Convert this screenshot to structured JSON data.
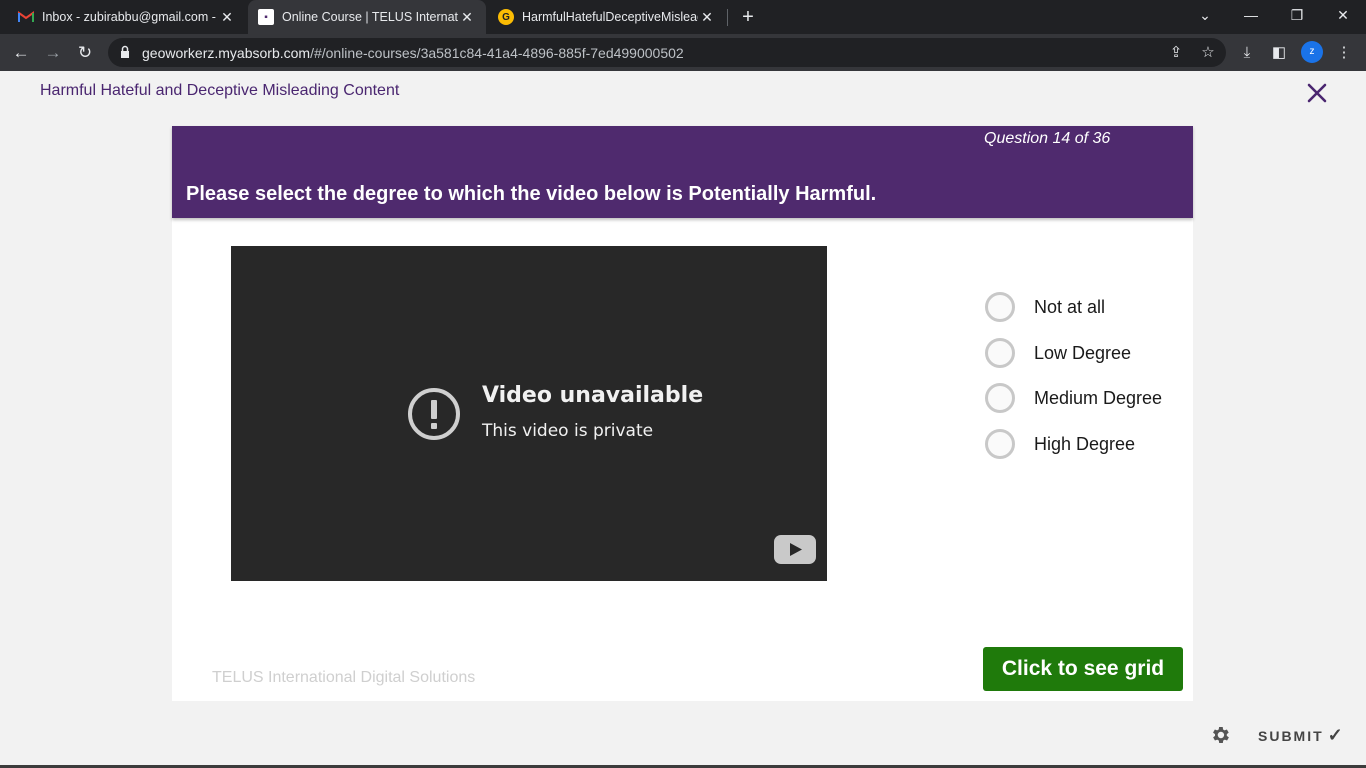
{
  "browser": {
    "tabs": [
      {
        "title": "Inbox - zubirabbu@gmail.com - G",
        "favicon": "gmail-icon",
        "active": false
      },
      {
        "title": "Online Course | TELUS Internation",
        "favicon": "telus-icon",
        "active": true
      },
      {
        "title": "HarmfulHatefulDeceptiveMisleadi",
        "favicon": "g-icon",
        "active": false
      }
    ],
    "url_host": "geoworkerz.myabsorb.com",
    "url_path": "/#/online-courses/3a581c84-41a4-4896-885f-7ed499000502",
    "profile_initial": "z"
  },
  "course": {
    "title": "Harmful Hateful and Deceptive Misleading Content"
  },
  "question": {
    "counter": "Question 14 of 36",
    "prompt": "Please select the degree to which the video below is Potentially Harmful."
  },
  "video": {
    "title": "Video unavailable",
    "subtitle": "This video is private"
  },
  "options": [
    {
      "label": "Not at all",
      "selected": false
    },
    {
      "label": "Low Degree",
      "selected": false
    },
    {
      "label": "Medium Degree",
      "selected": false
    },
    {
      "label": "High Degree",
      "selected": false
    }
  ],
  "footer": {
    "company": "TELUS International Digital Solutions",
    "grid_button": "Click to see grid"
  },
  "actions": {
    "submit_label": "SUBMIT"
  },
  "colors": {
    "brand_purple": "#4f2a6e",
    "grid_button_green": "#1f7a0b",
    "chrome_dark": "#202124"
  }
}
